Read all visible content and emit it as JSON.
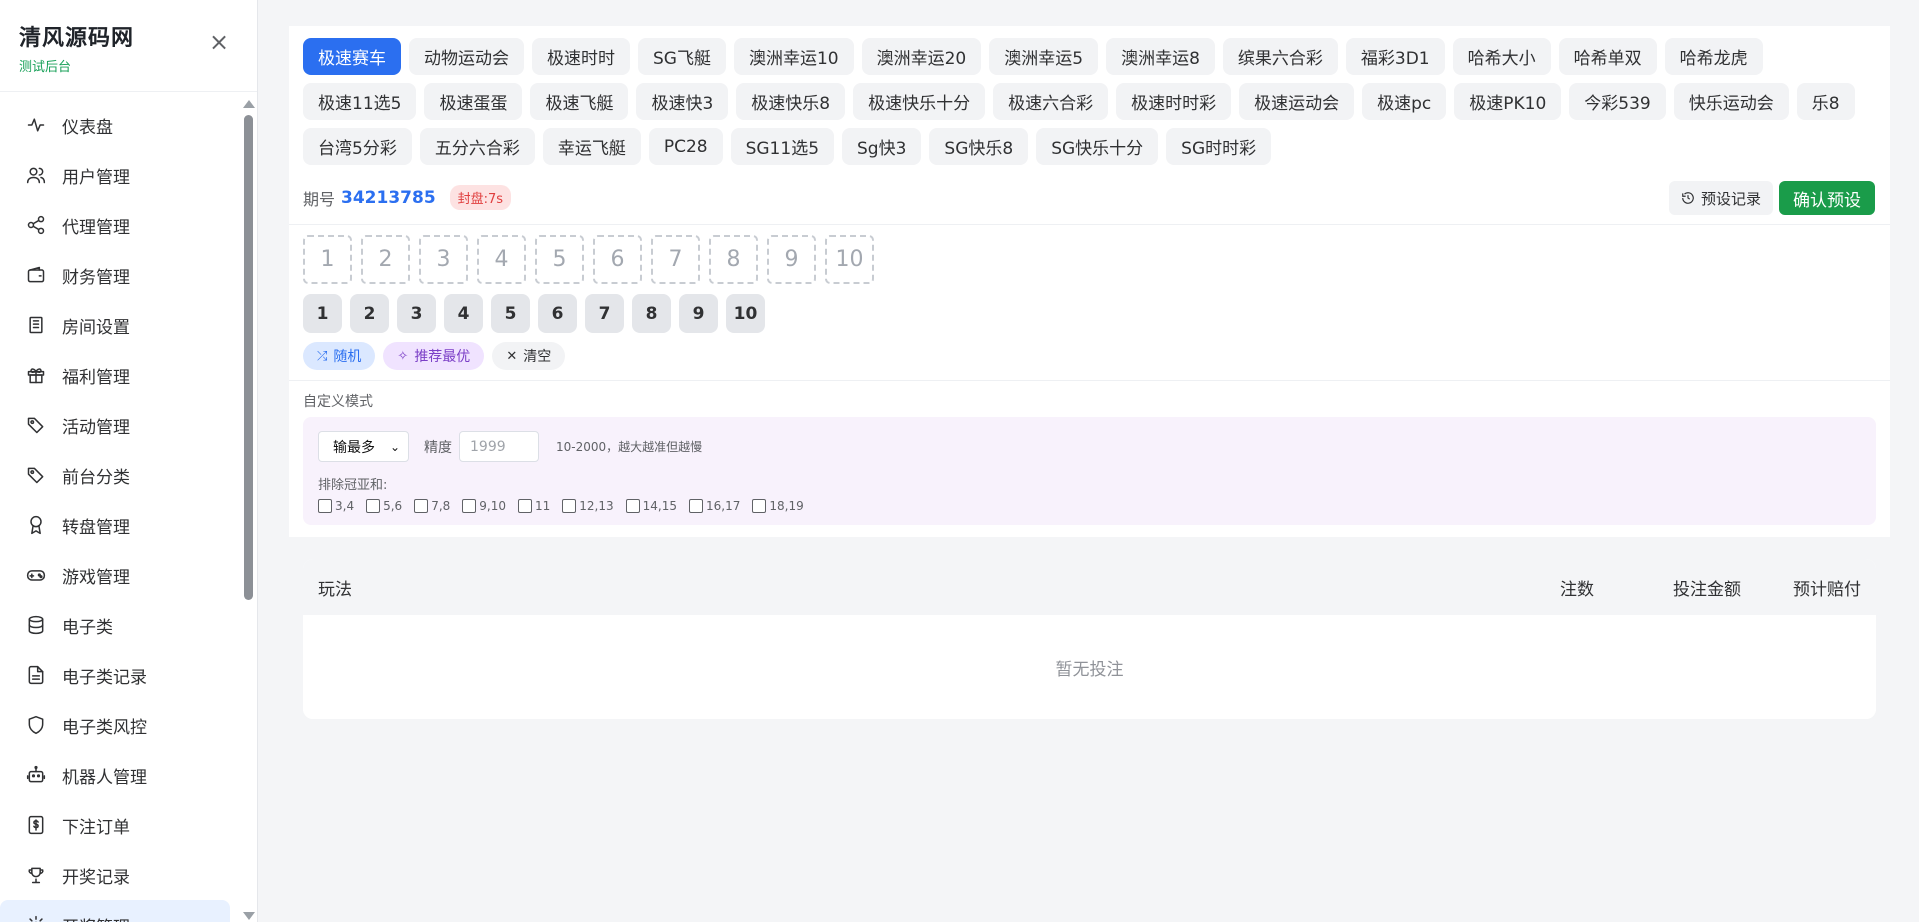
{
  "brand": {
    "title": "清风源码网",
    "subtitle": "测试后台"
  },
  "sidebar": {
    "items": [
      {
        "label": "仪表盘",
        "icon": "activity-icon"
      },
      {
        "label": "用户管理",
        "icon": "users-icon"
      },
      {
        "label": "代理管理",
        "icon": "share-icon"
      },
      {
        "label": "财务管理",
        "icon": "wallet-icon"
      },
      {
        "label": "房间设置",
        "icon": "building-icon"
      },
      {
        "label": "福利管理",
        "icon": "gift-icon"
      },
      {
        "label": "活动管理",
        "icon": "tags-icon"
      },
      {
        "label": "前台分类",
        "icon": "tags-icon"
      },
      {
        "label": "转盘管理",
        "icon": "award-icon"
      },
      {
        "label": "游戏管理",
        "icon": "gamepad-icon"
      },
      {
        "label": "电子类",
        "icon": "database-icon"
      },
      {
        "label": "电子类记录",
        "icon": "file-icon"
      },
      {
        "label": "电子类风控",
        "icon": "shield-icon"
      },
      {
        "label": "机器人管理",
        "icon": "bot-icon"
      },
      {
        "label": "下注订单",
        "icon": "dollar-file-icon"
      },
      {
        "label": "开奖记录",
        "icon": "trophy-icon"
      },
      {
        "label": "开奖管理",
        "icon": "settings-icon"
      }
    ]
  },
  "games": [
    "极速赛车",
    "动物运动会",
    "极速时时",
    "SG飞艇",
    "澳洲幸运10",
    "澳洲幸运20",
    "澳洲幸运5",
    "澳洲幸运8",
    "缤果六合彩",
    "福彩3D1",
    "哈希大小",
    "哈希单双",
    "哈希龙虎",
    "极速11选5",
    "极速蛋蛋",
    "极速飞艇",
    "极速快3",
    "极速快乐8",
    "极速快乐十分",
    "极速六合彩",
    "极速时时彩",
    "极速运动会",
    "极速pc",
    "极速PK10",
    "今彩539",
    "快乐运动会",
    "乐8",
    "台湾5分彩",
    "五分六合彩",
    "幸运飞艇",
    "PC28",
    "SG11选5",
    "Sg快3",
    "SG快乐8",
    "SG快乐十分",
    "SG时时彩"
  ],
  "active_game": "极速赛车",
  "period": {
    "label": "期号",
    "number": "34213785",
    "seal": "封盘:7s"
  },
  "actions": {
    "history": "预设记录",
    "confirm": "确认预设"
  },
  "slots": [
    "1",
    "2",
    "3",
    "4",
    "5",
    "6",
    "7",
    "8",
    "9",
    "10"
  ],
  "numbers": [
    "1",
    "2",
    "3",
    "4",
    "5",
    "6",
    "7",
    "8",
    "9",
    "10"
  ],
  "tools": {
    "random": "随机",
    "best": "推荐最优",
    "clear": "清空"
  },
  "custom": {
    "label": "自定义模式",
    "mode": "输最多",
    "precision_label": "精度",
    "precision_placeholder": "1999",
    "precision_hint": "10-2000，越大越准但越慢",
    "exclude_label": "排除冠亚和:",
    "exclude_options": [
      "3,4",
      "5,6",
      "7,8",
      "9,10",
      "11",
      "12,13",
      "14,15",
      "16,17",
      "18,19"
    ]
  },
  "bets": {
    "columns": {
      "play": "玩法",
      "count": "注数",
      "amount": "投注金额",
      "payout": "预计赔付"
    },
    "empty": "暂无投注"
  },
  "colors": {
    "primary": "#2b6ff0",
    "success": "#1a9c4a",
    "danger": "#e03e3e",
    "purple": "#7b3fc7"
  }
}
